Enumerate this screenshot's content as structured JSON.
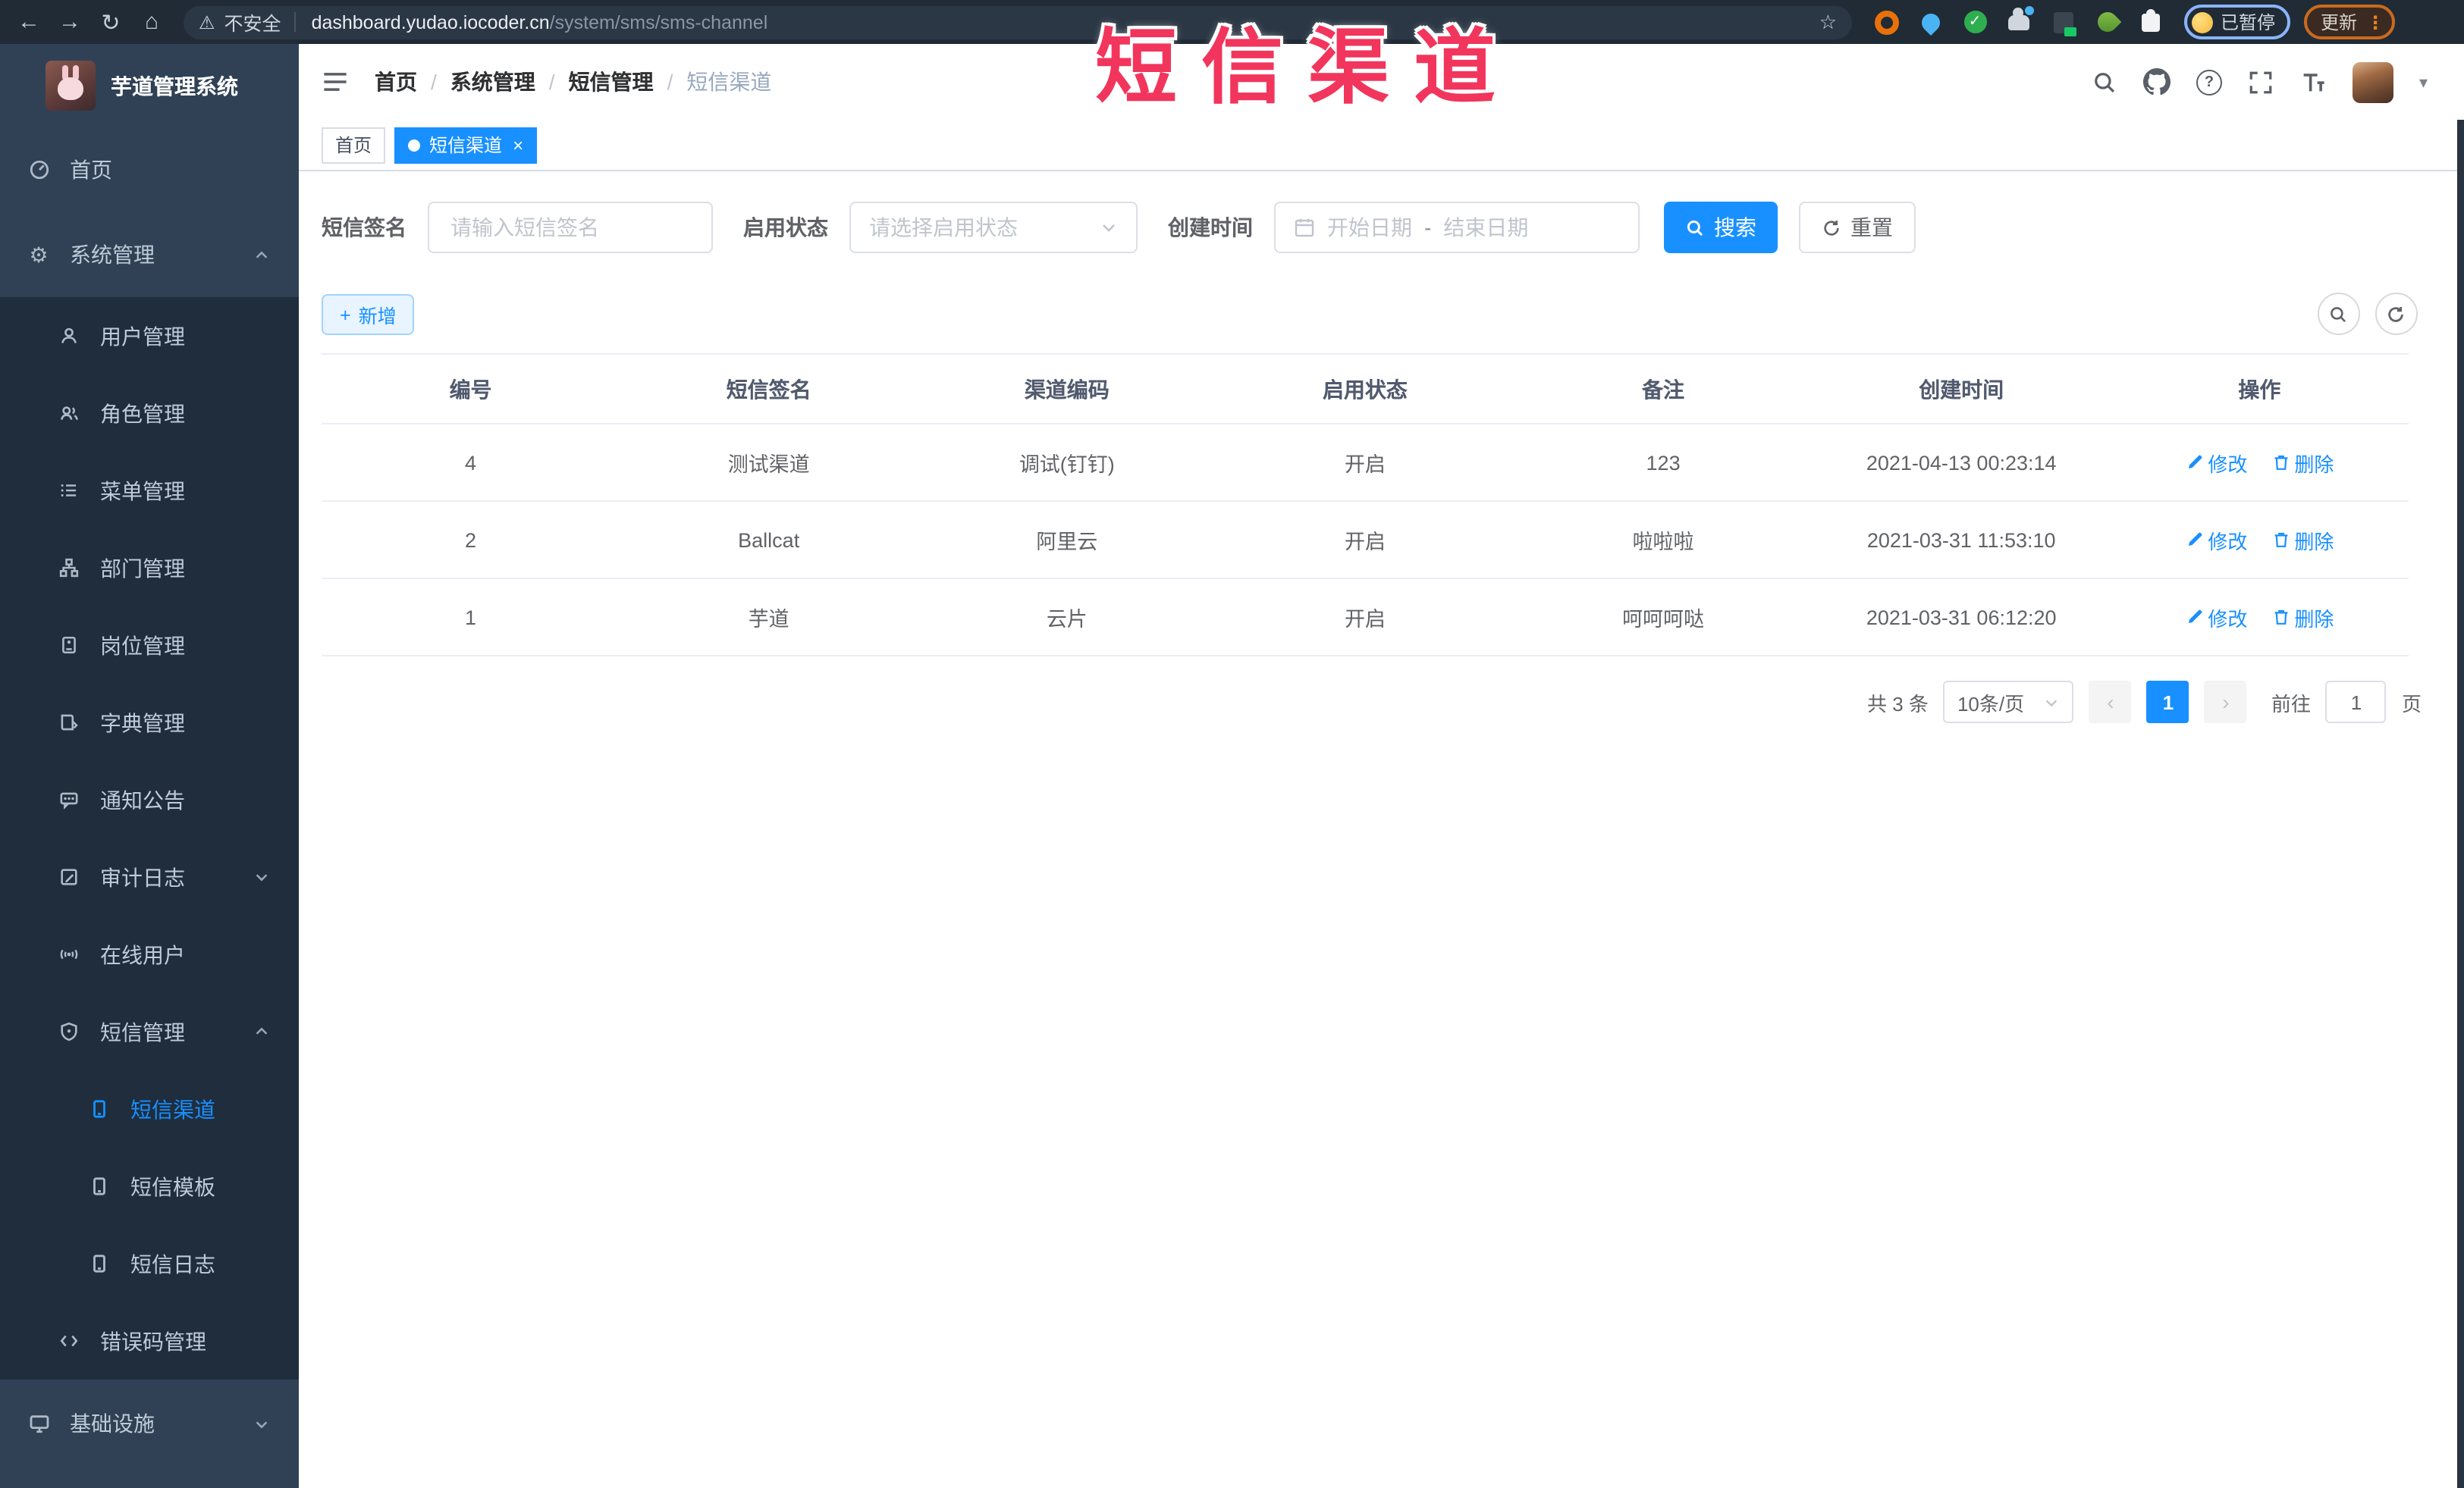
{
  "browser": {
    "security_label": "不安全",
    "url_domain": "dashboard.yudao.iocoder.cn",
    "url_path": "/system/sms/sms-channel",
    "profile_status": "已暂停",
    "update_label": "更新"
  },
  "overlay": {
    "title": "短信渠道",
    "color": "#f2355c"
  },
  "glyphs": {
    "back": "←",
    "forward": "→",
    "reload": "↻",
    "home": "⌂",
    "warning": "⚠",
    "star": "☆",
    "check": "✓",
    "menu_dots": "⋮",
    "gear": "⚙",
    "question": "?",
    "caret_down": "▾",
    "close": "×",
    "plus": "+",
    "prev": "‹",
    "next": "›"
  },
  "sidebar": {
    "logo_title": "芋道管理系统",
    "items": [
      {
        "label": "首页",
        "icon": "dashboard-icon"
      },
      {
        "label": "系统管理",
        "icon": "gear-icon"
      },
      {
        "label": "用户管理",
        "icon": "user-icon"
      },
      {
        "label": "角色管理",
        "icon": "users-icon"
      },
      {
        "label": "菜单管理",
        "icon": "list-icon"
      },
      {
        "label": "部门管理",
        "icon": "org-tree-icon"
      },
      {
        "label": "岗位管理",
        "icon": "id-badge-icon"
      },
      {
        "label": "字典管理",
        "icon": "dictionary-icon"
      },
      {
        "label": "通知公告",
        "icon": "announcement-icon"
      },
      {
        "label": "审计日志",
        "icon": "audit-log-icon"
      },
      {
        "label": "在线用户",
        "icon": "online-users-icon"
      },
      {
        "label": "短信管理",
        "icon": "sms-shield-icon"
      },
      {
        "label": "短信渠道",
        "icon": "phone-icon",
        "active": true
      },
      {
        "label": "短信模板",
        "icon": "phone-icon"
      },
      {
        "label": "短信日志",
        "icon": "phone-icon"
      },
      {
        "label": "错误码管理",
        "icon": "code-icon"
      },
      {
        "label": "基础设施",
        "icon": "monitor-icon"
      }
    ]
  },
  "breadcrumb": {
    "items": [
      "首页",
      "系统管理",
      "短信管理",
      "短信渠道"
    ],
    "separator": "/"
  },
  "tabs": [
    {
      "label": "首页"
    },
    {
      "label": "短信渠道",
      "active": true
    }
  ],
  "filters": {
    "signature_label": "短信签名",
    "signature_placeholder": "请输入短信签名",
    "status_label": "启用状态",
    "status_placeholder": "请选择启用状态",
    "created_label": "创建时间",
    "date_start_placeholder": "开始日期",
    "date_separator": "-",
    "date_end_placeholder": "结束日期",
    "search_label": "搜索",
    "reset_label": "重置"
  },
  "toolbar": {
    "add_label": "新增"
  },
  "table": {
    "columns": [
      "编号",
      "短信签名",
      "渠道编码",
      "启用状态",
      "备注",
      "创建时间",
      "操作"
    ],
    "edit_label": "修改",
    "delete_label": "删除",
    "rows": [
      {
        "id": "4",
        "signature": "测试渠道",
        "code": "调试(钉钉)",
        "status": "开启",
        "remark": "123",
        "created": "2021-04-13 00:23:14"
      },
      {
        "id": "2",
        "signature": "Ballcat",
        "code": "阿里云",
        "status": "开启",
        "remark": "啦啦啦",
        "created": "2021-03-31 11:53:10"
      },
      {
        "id": "1",
        "signature": "芋道",
        "code": "云片",
        "status": "开启",
        "remark": "呵呵呵哒",
        "created": "2021-03-31 06:12:20"
      }
    ]
  },
  "pagination": {
    "total_label": "共 3 条",
    "page_size": "10条/页",
    "current_page": "1",
    "goto_label": "前往",
    "goto_value": "1",
    "page_unit": "页"
  },
  "colors": {
    "primary": "#1890ff",
    "sidebar_bg": "#304156",
    "submenu_bg": "#1f2d3d",
    "overlay_red": "#f2355c",
    "browser_bar": "#202b36"
  }
}
